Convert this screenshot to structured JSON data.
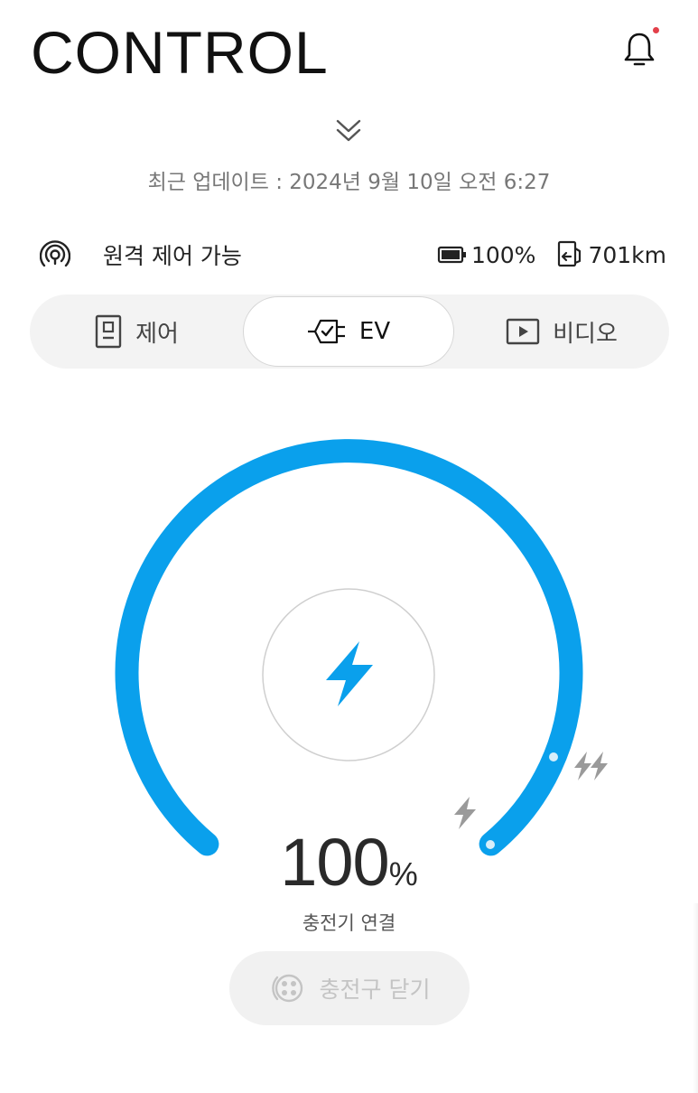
{
  "header": {
    "title": "CONTROL",
    "notification_icon": "bell-icon",
    "has_unread": true
  },
  "update": {
    "text": "최근 업데이트 : 2024년 9월 10일 오전 6:27"
  },
  "status": {
    "remote_label": "원격 제어 가능",
    "battery": "100%",
    "range": "701km"
  },
  "tabs": [
    {
      "label": "제어",
      "icon": "control-panel-icon",
      "selected": false
    },
    {
      "label": "EV",
      "icon": "ev-check-icon",
      "selected": true
    },
    {
      "label": "비디오",
      "icon": "video-play-icon",
      "selected": false
    }
  ],
  "gauge": {
    "level": 100,
    "percent_value": "100",
    "percent_unit": "%",
    "status": "충전기 연결",
    "colors": {
      "arc": "#0aa0ec",
      "bolt": "#0aa0ec",
      "muted": "#9a9a9a"
    }
  },
  "actions": {
    "close_port_label": "충전구 닫기",
    "close_port_enabled": false
  }
}
